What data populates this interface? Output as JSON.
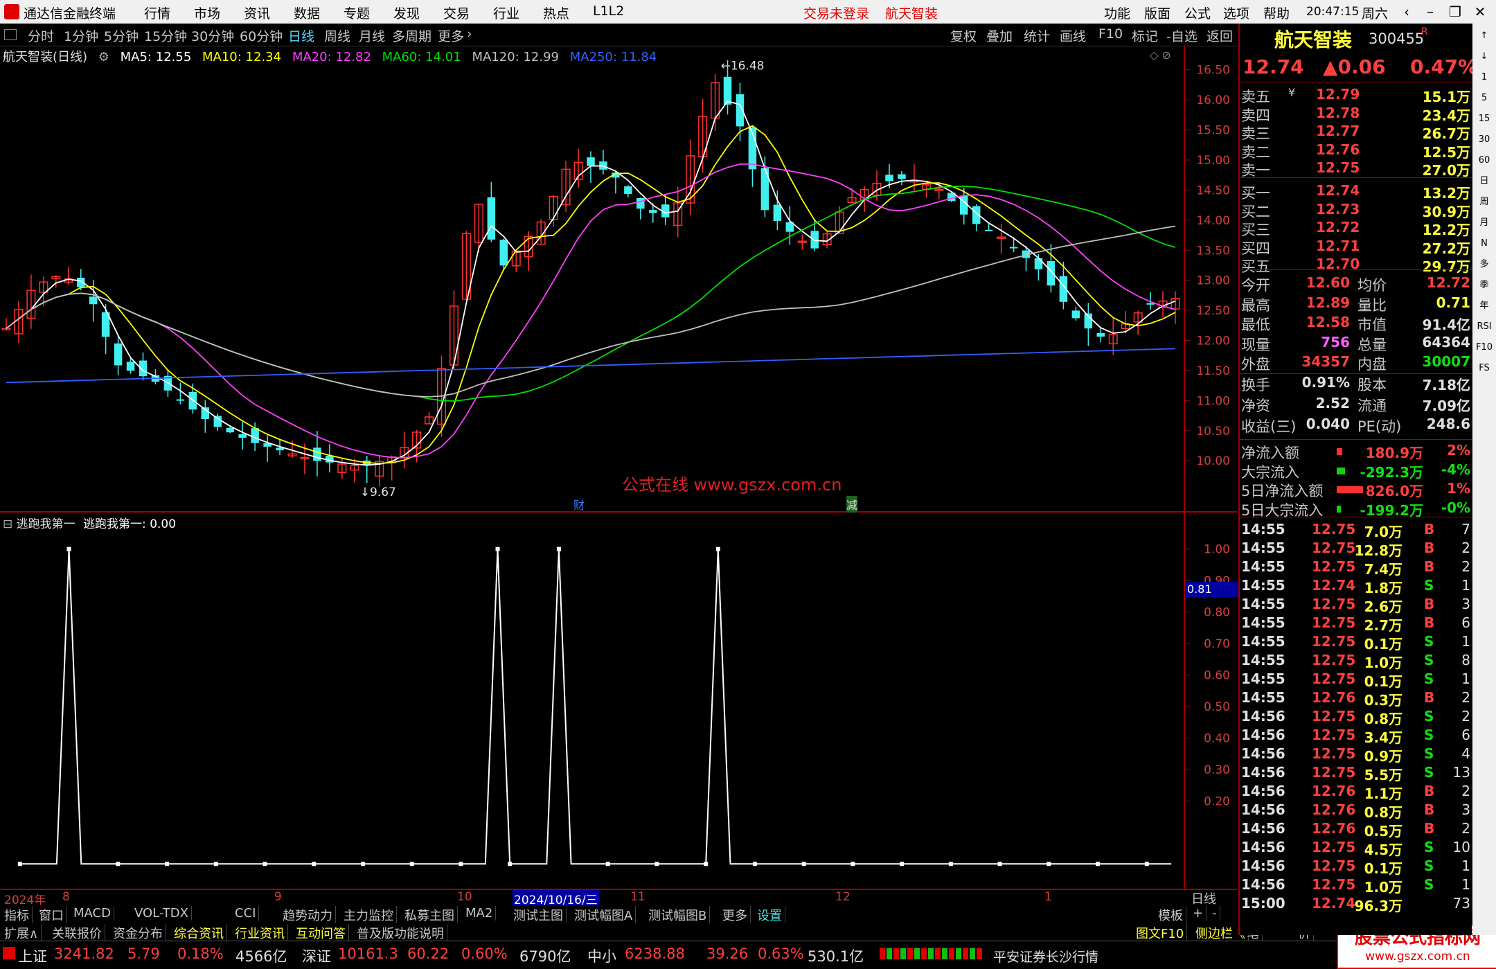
{
  "menu": {
    "app_title": "通达信金融终端",
    "items": [
      "行情",
      "市场",
      "资讯",
      "数据",
      "专题",
      "发现",
      "交易",
      "行业",
      "热点",
      "L1L2"
    ],
    "trade_status": "交易未登录",
    "stock_tag": "航天智装",
    "right_items": [
      "功能",
      "版面",
      "公式",
      "选项",
      "帮助"
    ],
    "time": "20:47:15",
    "weekday": "周六"
  },
  "periods": [
    "分时",
    "1分钟",
    "5分钟",
    "15分钟",
    "30分钟",
    "60分钟",
    "日线",
    "周线",
    "月线",
    "多周期",
    "更多"
  ],
  "active_period": "日线",
  "toolbar": [
    "复权",
    "叠加",
    "统计",
    "画线",
    "F10",
    "标记",
    "-自选",
    "返回"
  ],
  "main_chart": {
    "title": "航天智装(日线)",
    "ma_legend": [
      {
        "label": "MA5: 12.55",
        "color": "#ffffff"
      },
      {
        "label": "MA10: 12.34",
        "color": "#ffff00"
      },
      {
        "label": "MA20: 12.82",
        "color": "#ff40ff"
      },
      {
        "label": "MA60: 14.01",
        "color": "#00e000"
      },
      {
        "label": "MA120: 12.99",
        "color": "#c0c0c0"
      },
      {
        "label": "MA250: 11.84",
        "color": "#3060ff"
      }
    ],
    "high_label": "16.48",
    "low_label": "9.67",
    "watermark": "公式在线 www.gszx.com.cn",
    "event_markers": [
      "财",
      "减"
    ]
  },
  "chart_data": [
    {
      "type": "candlestick",
      "title": "航天智装(日线)",
      "y_ticks": [
        16.5,
        16.0,
        15.5,
        15.0,
        14.5,
        14.0,
        13.5,
        13.0,
        12.5,
        12.0,
        11.5,
        11.0,
        10.5,
        10.0
      ],
      "ylim": [
        9.3,
        16.9
      ],
      "x_labels": [
        "2024年",
        "8",
        "9",
        "10",
        "2024/10/16/三",
        "11",
        "12",
        "1"
      ],
      "high": 16.48,
      "low": 9.67,
      "last_ma": {
        "MA5": 12.55,
        "MA10": 12.34,
        "MA20": 12.82,
        "MA60": 14.01,
        "MA120": 12.99,
        "MA250": 11.84
      }
    },
    {
      "type": "line",
      "title": "逃跑我第一",
      "legend": "逃跑我第一: 0.00",
      "y_ticks": [
        1.0,
        0.9,
        0.8,
        0.7,
        0.6,
        0.5,
        0.4,
        0.3,
        0.2
      ],
      "ylim": [
        -0.05,
        1.05
      ],
      "cursor_value": "0.81",
      "spikes_at_bars": [
        4,
        39,
        44,
        57
      ],
      "bar_count": 95
    }
  ],
  "quote": {
    "name": "航天智装",
    "code": "300455",
    "suffix": "R",
    "price": "12.74",
    "change": "▲0.06",
    "pct": "0.47%",
    "asks": [
      {
        "label": "卖五",
        "price": "12.79",
        "vol": "15.1万",
        "mark": "¥"
      },
      {
        "label": "卖四",
        "price": "12.78",
        "vol": "23.4万",
        "mark": ""
      },
      {
        "label": "卖三",
        "price": "12.77",
        "vol": "26.7万",
        "mark": ""
      },
      {
        "label": "卖二",
        "price": "12.76",
        "vol": "12.5万",
        "mark": ""
      },
      {
        "label": "卖一",
        "price": "12.75",
        "vol": "27.0万",
        "mark": ""
      }
    ],
    "bids": [
      {
        "label": "买一",
        "price": "12.74",
        "vol": "13.2万"
      },
      {
        "label": "买二",
        "price": "12.73",
        "vol": "30.9万"
      },
      {
        "label": "买三",
        "price": "12.72",
        "vol": "12.2万"
      },
      {
        "label": "买四",
        "price": "12.71",
        "vol": "27.2万"
      },
      {
        "label": "买五",
        "price": "12.70",
        "vol": "29.7万"
      }
    ],
    "stats": [
      {
        "l1": "今开",
        "v1": "12.60",
        "c1": "r",
        "l2": "均价",
        "v2": "12.72",
        "c2": "r"
      },
      {
        "l1": "最高",
        "v1": "12.89",
        "c1": "r",
        "l2": "量比",
        "v2": "0.71",
        "c2": "y"
      },
      {
        "l1": "最低",
        "v1": "12.58",
        "c1": "r",
        "l2": "市值",
        "v2": "91.4亿",
        "c2": "w"
      },
      {
        "l1": "现量",
        "v1": "756",
        "c1": "m",
        "l2": "总量",
        "v2": "64364",
        "c2": "w"
      },
      {
        "l1": "外盘",
        "v1": "34357",
        "c1": "r",
        "l2": "内盘",
        "v2": "30007",
        "c2": "g"
      }
    ],
    "stats2": [
      {
        "l1": "换手",
        "v1": "0.91%",
        "c1": "w",
        "l2": "股本",
        "v2": "7.18亿",
        "c2": "w"
      },
      {
        "l1": "净资",
        "v1": "2.52",
        "c1": "w",
        "l2": "流通",
        "v2": "7.09亿",
        "c2": "w"
      },
      {
        "l1": "收益(三)",
        "v1": "0.040",
        "c1": "w",
        "l2": "PE(动)",
        "v2": "248.6",
        "c2": "w"
      }
    ],
    "flows": [
      {
        "label": "净流入额",
        "val": "180.9万",
        "pct": "2%",
        "c": "r",
        "bar": "r",
        "barw": 8
      },
      {
        "label": "大宗流入",
        "val": "-292.3万",
        "pct": "-4%",
        "c": "g",
        "bar": "g",
        "barw": 12
      },
      {
        "label": "5日净流入额",
        "val": "826.0万",
        "pct": "1%",
        "c": "r",
        "bar": "r",
        "barw": 38
      },
      {
        "label": "5日大宗流入",
        "val": "-199.2万",
        "pct": "-0%",
        "c": "g",
        "bar": "g",
        "barw": 6
      }
    ],
    "ticks": [
      {
        "t": "14:55",
        "p": "12.75",
        "v": "7.0万",
        "s": "B",
        "n": "7"
      },
      {
        "t": "14:55",
        "p": "12.75",
        "v": "12.8万",
        "s": "B",
        "n": "2"
      },
      {
        "t": "14:55",
        "p": "12.75",
        "v": "7.4万",
        "s": "B",
        "n": "2"
      },
      {
        "t": "14:55",
        "p": "12.74",
        "v": "1.8万",
        "s": "S",
        "n": "1"
      },
      {
        "t": "14:55",
        "p": "12.75",
        "v": "2.6万",
        "s": "B",
        "n": "3"
      },
      {
        "t": "14:55",
        "p": "12.75",
        "v": "2.7万",
        "s": "B",
        "n": "6"
      },
      {
        "t": "14:55",
        "p": "12.75",
        "v": "0.1万",
        "s": "S",
        "n": "1"
      },
      {
        "t": "14:55",
        "p": "12.75",
        "v": "1.0万",
        "s": "S",
        "n": "8"
      },
      {
        "t": "14:55",
        "p": "12.75",
        "v": "0.1万",
        "s": "S",
        "n": "1"
      },
      {
        "t": "14:55",
        "p": "12.76",
        "v": "0.3万",
        "s": "B",
        "n": "2"
      },
      {
        "t": "14:56",
        "p": "12.75",
        "v": "0.8万",
        "s": "S",
        "n": "2"
      },
      {
        "t": "14:56",
        "p": "12.75",
        "v": "3.4万",
        "s": "S",
        "n": "6"
      },
      {
        "t": "14:56",
        "p": "12.75",
        "v": "0.9万",
        "s": "S",
        "n": "4"
      },
      {
        "t": "14:56",
        "p": "12.75",
        "v": "5.5万",
        "s": "S",
        "n": "13"
      },
      {
        "t": "14:56",
        "p": "12.76",
        "v": "1.1万",
        "s": "B",
        "n": "2"
      },
      {
        "t": "14:56",
        "p": "12.76",
        "v": "0.8万",
        "s": "B",
        "n": "3"
      },
      {
        "t": "14:56",
        "p": "12.76",
        "v": "0.5万",
        "s": "B",
        "n": "2"
      },
      {
        "t": "14:56",
        "p": "12.75",
        "v": "4.5万",
        "s": "S",
        "n": "10"
      },
      {
        "t": "14:56",
        "p": "12.75",
        "v": "0.1万",
        "s": "S",
        "n": "1"
      },
      {
        "t": "14:56",
        "p": "12.75",
        "v": "1.0万",
        "s": "S",
        "n": "1"
      },
      {
        "t": "15:00",
        "p": "12.74",
        "v": "96.3万",
        "s": "",
        "n": "73"
      }
    ]
  },
  "bottom_tabs": [
    "指标",
    "窗口",
    "MACD",
    "VOL-TDX",
    "CCI",
    "趋势动力",
    "主力监控",
    "私募主图",
    "MA2",
    "测试主图",
    "测试幅图A",
    "测试幅图B",
    "更多",
    "设置"
  ],
  "bottom_right": [
    "模板",
    "+",
    "-",
    "日线"
  ],
  "extend_tabs": [
    "扩展∧",
    "关联报价",
    "资金分布",
    "综合资讯",
    "行业资讯",
    "互动问答",
    "普及版功能说明"
  ],
  "extend_right": [
    "图文F10",
    "侧边栏《"
  ],
  "quote_tabs": [
    "笔",
    "价",
    "细",
    "势"
  ],
  "status": {
    "indices": [
      {
        "name": "上证",
        "val": "3241.82",
        "chg": "5.79",
        "pct": "0.18%",
        "amt": "4566亿"
      },
      {
        "name": "深证",
        "val": "10161.3",
        "chg": "60.22",
        "pct": "0.60%",
        "amt": "6790亿"
      },
      {
        "name": "中小",
        "val": "6238.88",
        "chg": "39.26",
        "pct": "0.63%",
        "amt": "530.1亿"
      }
    ],
    "broker": "平安证券长沙行情",
    "corner_logo": "股票公式指标网",
    "corner_url": "www.gszx.com.cn"
  },
  "side_icons": [
    "↑",
    "↓",
    "1",
    "5",
    "15",
    "30",
    "60",
    "日",
    "周",
    "月",
    "N",
    "多",
    "季",
    "年",
    "RSI",
    "F10",
    "FS"
  ]
}
